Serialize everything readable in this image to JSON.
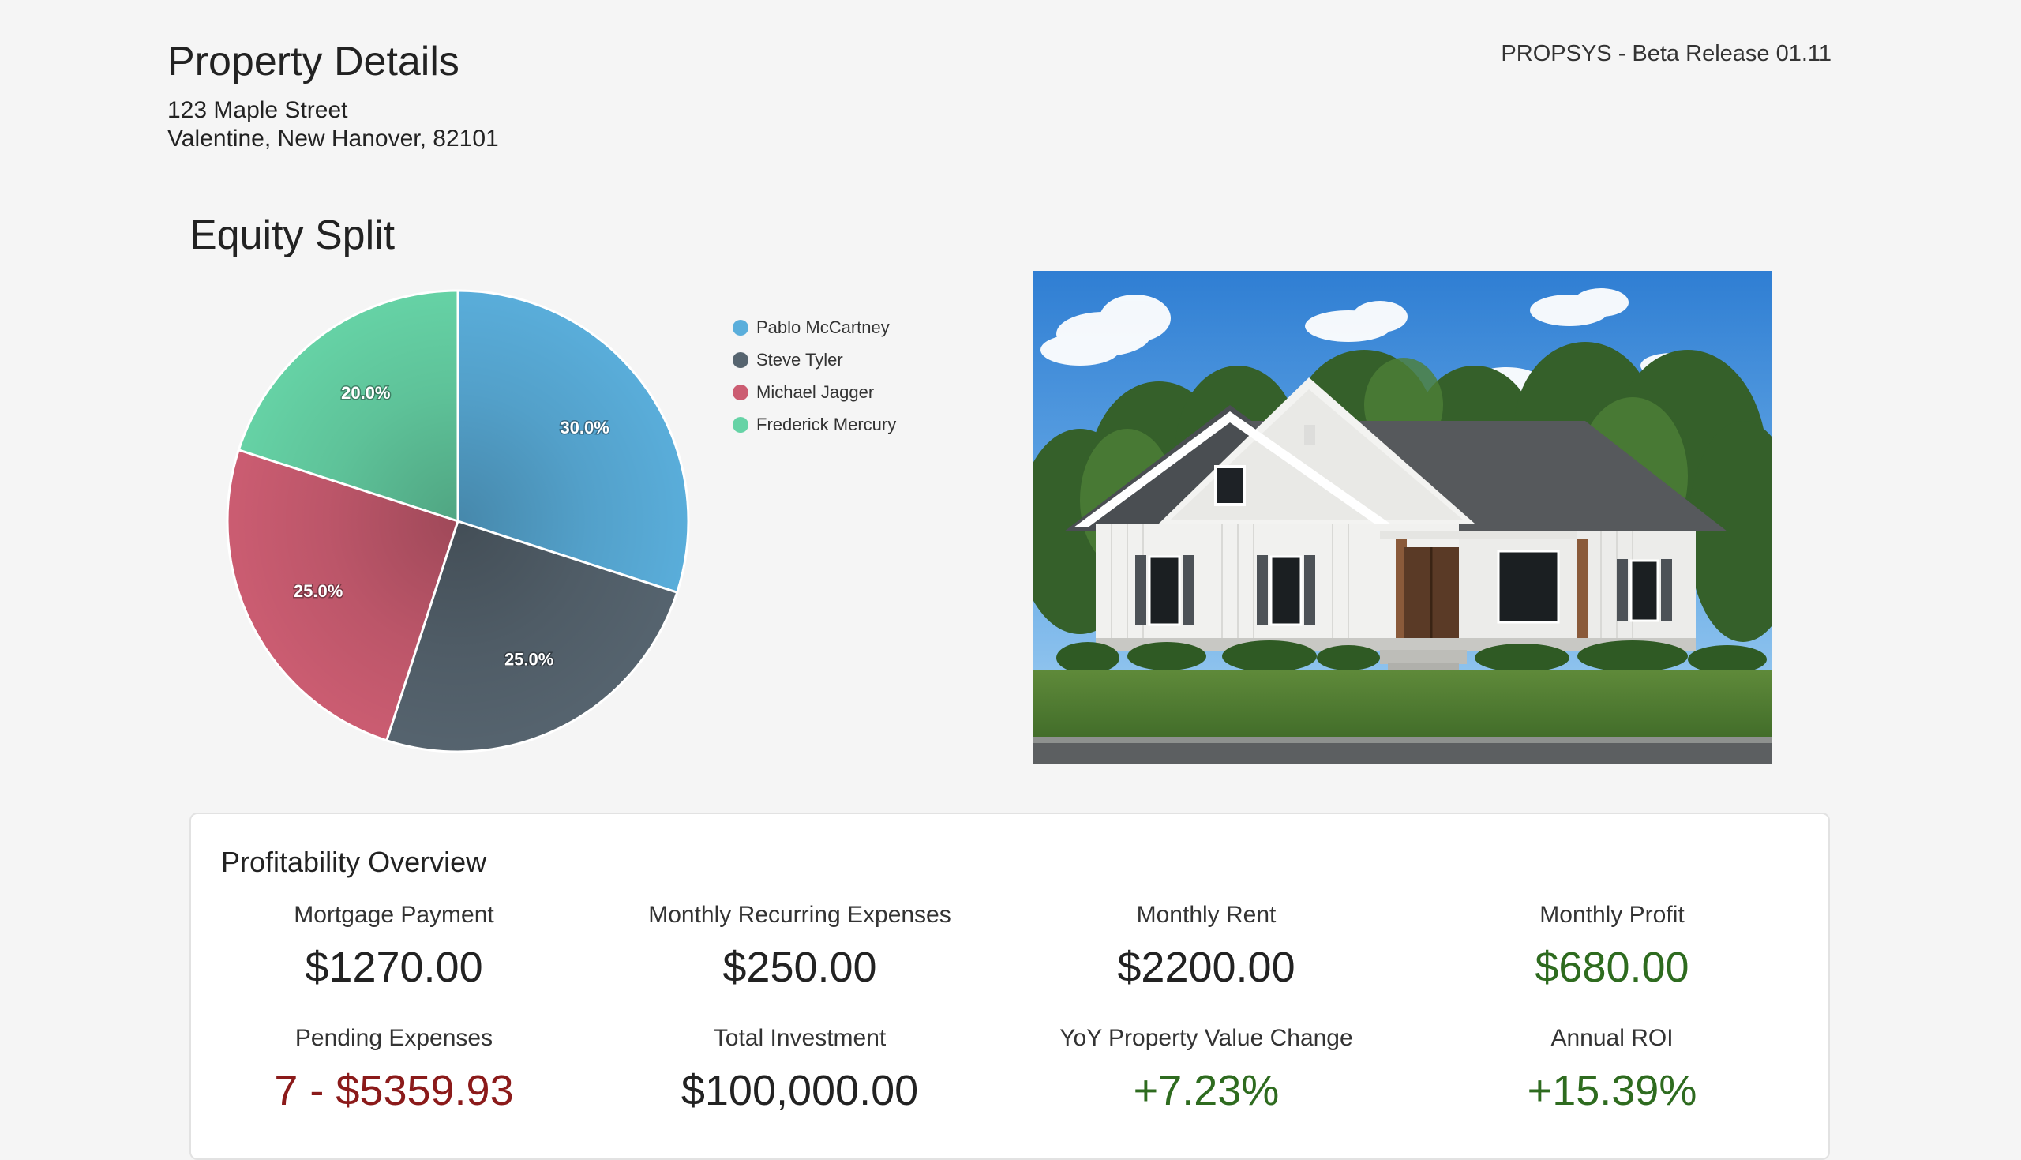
{
  "header": {
    "title": "Property Details",
    "address_line1": "123 Maple Street",
    "address_line2": "Valentine, New Hanover, 82101",
    "release": "PROPSYS - Beta Release 01.11"
  },
  "equity": {
    "title": "Equity Split"
  },
  "chart_data": {
    "type": "pie",
    "title": "Equity Split",
    "categories": [
      "Pablo McCartney",
      "Steve Tyler",
      "Michael Jagger",
      "Frederick Mercury"
    ],
    "values": [
      30.0,
      25.0,
      25.0,
      20.0
    ],
    "labels": [
      "30.0%",
      "25.0%",
      "25.0%",
      "20.0%"
    ],
    "colors": [
      "#5aaedb",
      "#56646f",
      "#cc5d72",
      "#66d3a6"
    ],
    "legend_position": "right",
    "start_angle": "top, clockwise"
  },
  "property_image": {
    "icon": "house-photo"
  },
  "profitability": {
    "title": "Profitability Overview",
    "metrics": [
      {
        "label": "Mortgage Payment",
        "value": "$1270.00",
        "color": "#222222"
      },
      {
        "label": "Monthly Recurring Expenses",
        "value": "$250.00",
        "color": "#222222"
      },
      {
        "label": "Monthly Rent",
        "value": "$2200.00",
        "color": "#222222"
      },
      {
        "label": "Monthly Profit",
        "value": "$680.00",
        "color": "#2e6b1f"
      },
      {
        "label": "Pending Expenses",
        "value": "7 - $5359.93",
        "color": "#8b1a1a"
      },
      {
        "label": "Total Investment",
        "value": "$100,000.00",
        "color": "#222222"
      },
      {
        "label": "YoY Property Value Change",
        "value": "+7.23%",
        "color": "#2e6b1f"
      },
      {
        "label": "Annual ROI",
        "value": "+15.39%",
        "color": "#2e6b1f"
      }
    ]
  }
}
